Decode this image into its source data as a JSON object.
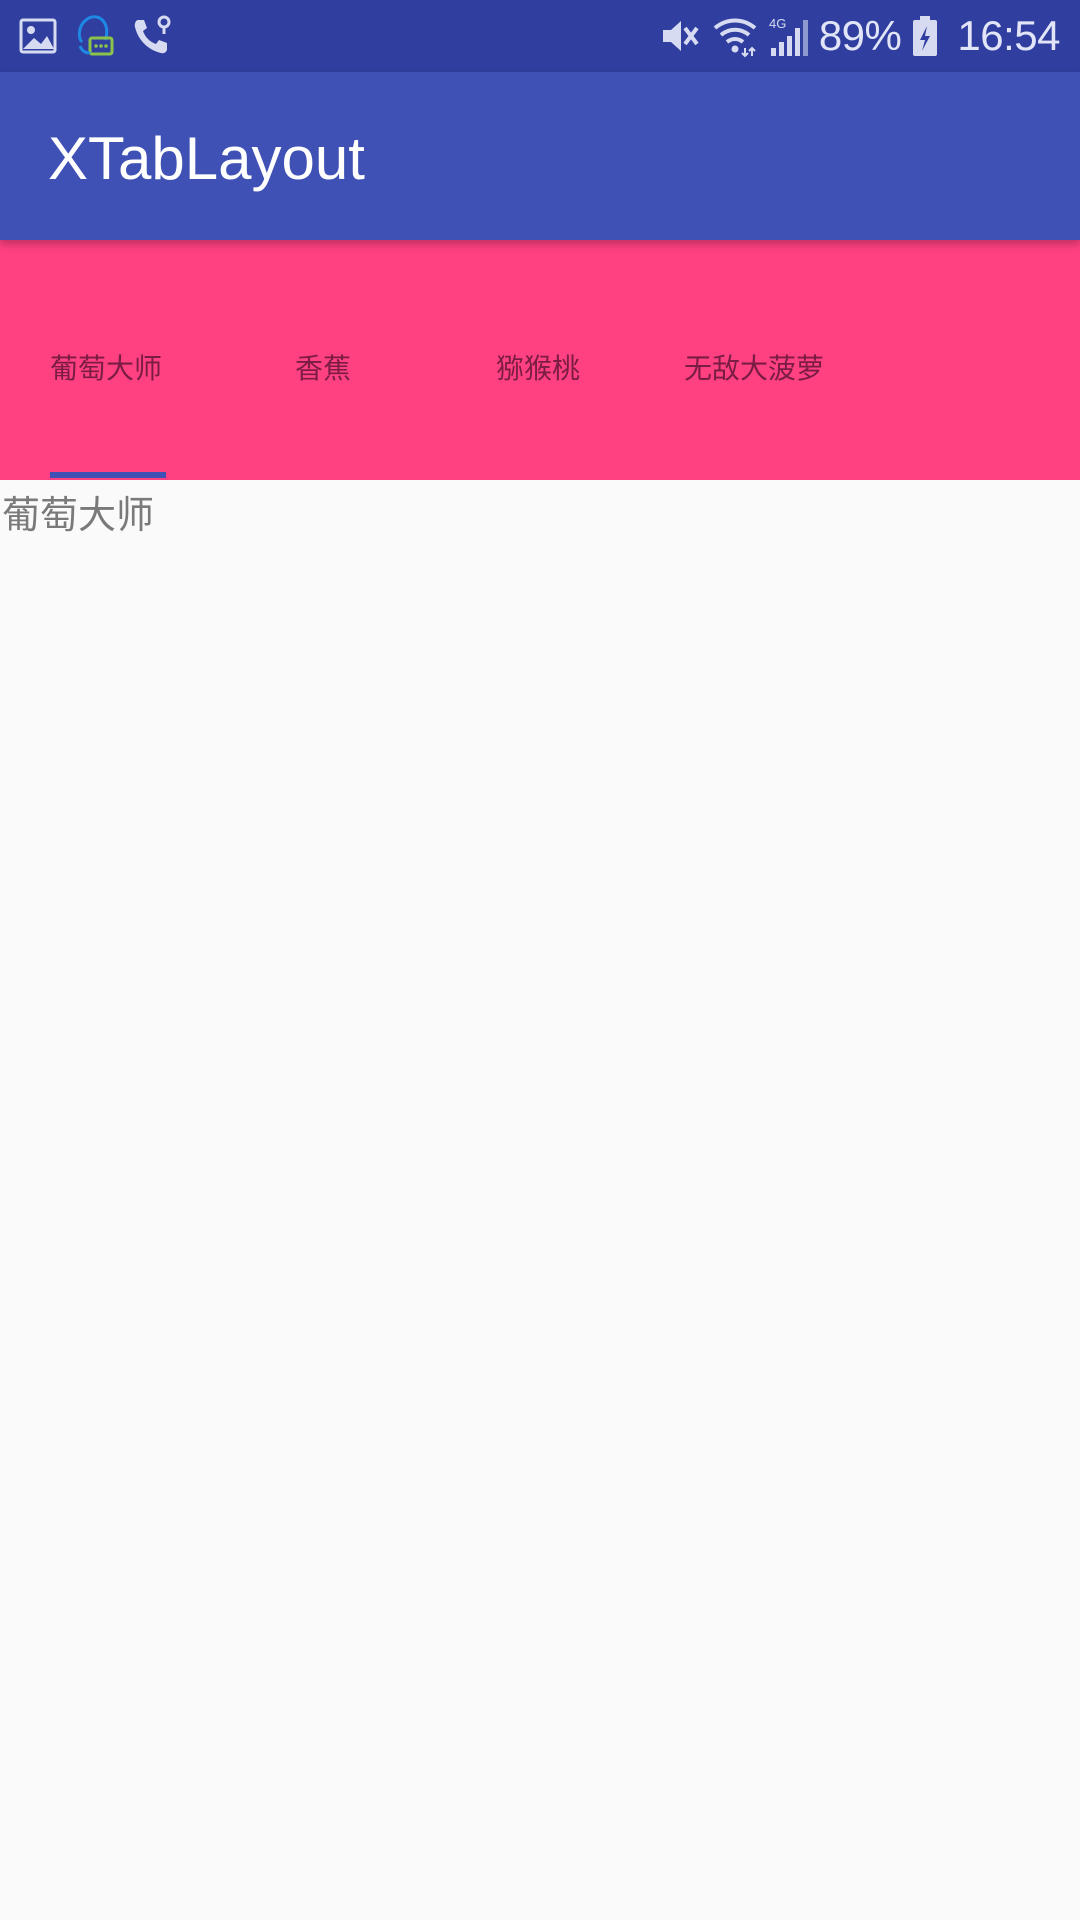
{
  "status_bar": {
    "battery": "89%",
    "time": "16:54",
    "network": "4G",
    "icons": [
      "image-icon",
      "qq-icon",
      "call-location-icon",
      "mute-icon",
      "wifi-icon",
      "signal-icon",
      "battery-charging-icon"
    ]
  },
  "app_bar": {
    "title": "XTabLayout",
    "color": "#3f51b5"
  },
  "tabs": {
    "items": [
      {
        "label": "葡萄大师",
        "selected": true
      },
      {
        "label": "香蕉",
        "selected": false
      },
      {
        "label": "猕猴桃",
        "selected": false
      },
      {
        "label": "无敌大菠萝",
        "selected": false
      }
    ],
    "background": "#ff4081",
    "indicator_color": "#3f51b5"
  },
  "content": {
    "text": "葡萄大师"
  }
}
